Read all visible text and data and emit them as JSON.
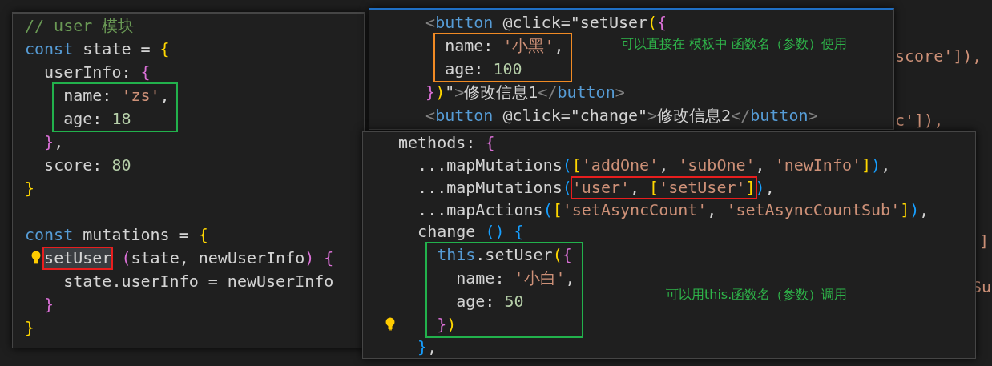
{
  "backdrop": {
    "fragments": [
      {
        "text": "score']),"
      },
      {
        "text": "c']),"
      },
      {
        "text": "]"
      },
      {
        "text": "Su"
      }
    ]
  },
  "panels": [
    {
      "accent": false,
      "blocks": [
        {
          "lines": [
            {
              "segments": [
                {
                  "tokens": [
                    {
                      "kind": "comment",
                      "text": "// user 模块"
                    }
                  ]
                }
              ]
            },
            {
              "segments": [
                {
                  "tokens": [
                    {
                      "kind": "keyword",
                      "text": "const"
                    },
                    {
                      "kind": "plain",
                      "text": " state = "
                    },
                    {
                      "kind": "bracket-1",
                      "text": "{"
                    }
                  ]
                }
              ]
            },
            {
              "segments": [
                {
                  "tokens": [
                    {
                      "kind": "plain",
                      "text": "  userInfo: "
                    },
                    {
                      "kind": "bracket-2",
                      "text": "{"
                    }
                  ]
                }
              ]
            }
          ]
        },
        {
          "color": "#22b14c",
          "lines": [
            {
              "segments": [
                {
                  "tokens": [
                    {
                      "kind": "plain",
                      "text": "    name: "
                    },
                    {
                      "kind": "string",
                      "text": "'zs'"
                    },
                    {
                      "kind": "plain",
                      "text": ","
                    }
                  ]
                }
              ]
            },
            {
              "segments": [
                {
                  "tokens": [
                    {
                      "kind": "plain",
                      "text": "    age: "
                    },
                    {
                      "kind": "number",
                      "text": "18"
                    }
                  ]
                }
              ]
            }
          ]
        },
        {
          "lines": [
            {
              "segments": [
                {
                  "tokens": [
                    {
                      "kind": "bracket-2",
                      "text": "  }"
                    },
                    {
                      "kind": "plain",
                      "text": ","
                    }
                  ]
                }
              ]
            },
            {
              "segments": [
                {
                  "tokens": [
                    {
                      "kind": "plain",
                      "text": "  score: "
                    },
                    {
                      "kind": "number",
                      "text": "80"
                    }
                  ]
                }
              ]
            },
            {
              "segments": [
                {
                  "tokens": [
                    {
                      "kind": "bracket-1",
                      "text": "}"
                    }
                  ]
                }
              ]
            },
            {
              "gap_before": true,
              "segments": [
                {
                  "tokens": [
                    {
                      "kind": "keyword",
                      "text": "const"
                    },
                    {
                      "kind": "plain",
                      "text": " mutations = "
                    },
                    {
                      "kind": "bracket-1",
                      "text": "{"
                    }
                  ]
                }
              ]
            },
            {
              "bulb": true,
              "segments": [
                {
                  "color": "#e81e1e",
                  "highlighted": true,
                  "tokens": [
                    {
                      "kind": "plain",
                      "text": "  setUser"
                    }
                  ]
                },
                {
                  "tokens": [
                    {
                      "kind": "bracket-2",
                      "text": " ("
                    },
                    {
                      "kind": "plain",
                      "text": "state, newUserInfo"
                    },
                    {
                      "kind": "bracket-2",
                      "text": ")"
                    },
                    {
                      "kind": "bracket-2",
                      "text": " {"
                    }
                  ]
                }
              ]
            },
            {
              "segments": [
                {
                  "tokens": [
                    {
                      "kind": "plain",
                      "text": "    state.userInfo = newUserInfo"
                    }
                  ]
                }
              ]
            },
            {
              "segments": [
                {
                  "tokens": [
                    {
                      "kind": "bracket-2",
                      "text": "  }"
                    }
                  ]
                }
              ]
            },
            {
              "segments": [
                {
                  "tokens": [
                    {
                      "kind": "bracket-1",
                      "text": "}"
                    }
                  ]
                }
              ]
            }
          ]
        }
      ]
    },
    {
      "accent": true,
      "note": "可以直接在 模板中 函数名（参数）使用",
      "blocks": [
        {
          "lines": [
            {
              "segments": [
                {
                  "tokens": [
                    {
                      "kind": "tag-punct",
                      "text": "  <"
                    },
                    {
                      "kind": "tag",
                      "text": "button"
                    },
                    {
                      "kind": "plain",
                      "text": " @click=\"setUser"
                    },
                    {
                      "kind": "bracket-1",
                      "text": "("
                    },
                    {
                      "kind": "bracket-2",
                      "text": "{"
                    }
                  ]
                }
              ]
            }
          ]
        },
        {
          "color": "#f08a24",
          "lines": [
            {
              "segments": [
                {
                  "tokens": [
                    {
                      "kind": "plain",
                      "text": "    name: "
                    },
                    {
                      "kind": "string",
                      "text": "'小黑'"
                    },
                    {
                      "kind": "plain",
                      "text": ","
                    }
                  ]
                }
              ]
            },
            {
              "segments": [
                {
                  "tokens": [
                    {
                      "kind": "plain",
                      "text": "    age: "
                    },
                    {
                      "kind": "number",
                      "text": "100"
                    }
                  ]
                }
              ]
            }
          ]
        },
        {
          "lines": [
            {
              "segments": [
                {
                  "tokens": [
                    {
                      "kind": "bracket-2",
                      "text": "  }"
                    },
                    {
                      "kind": "bracket-1",
                      "text": ")"
                    },
                    {
                      "kind": "plain",
                      "text": "\""
                    },
                    {
                      "kind": "tag-punct",
                      "text": ">"
                    },
                    {
                      "kind": "plain",
                      "text": "修改信息1"
                    },
                    {
                      "kind": "tag-punct",
                      "text": "</"
                    },
                    {
                      "kind": "tag",
                      "text": "button"
                    },
                    {
                      "kind": "tag-punct",
                      "text": ">"
                    }
                  ]
                }
              ]
            },
            {
              "segments": [
                {
                  "tokens": [
                    {
                      "kind": "tag-punct",
                      "text": "  <"
                    },
                    {
                      "kind": "tag",
                      "text": "button"
                    },
                    {
                      "kind": "plain",
                      "text": " @click=\"change\""
                    },
                    {
                      "kind": "tag-punct",
                      "text": ">"
                    },
                    {
                      "kind": "plain",
                      "text": "修改信息2"
                    },
                    {
                      "kind": "tag-punct",
                      "text": "</"
                    },
                    {
                      "kind": "tag",
                      "text": "button"
                    },
                    {
                      "kind": "tag-punct",
                      "text": ">"
                    }
                  ]
                }
              ]
            }
          ]
        }
      ]
    },
    {
      "accent": false,
      "note": "可以用this.函数名（参数）调用",
      "blocks": [
        {
          "lines": [
            {
              "segments": [
                {
                  "tokens": [
                    {
                      "kind": "plain",
                      "text": "methods: "
                    },
                    {
                      "kind": "bracket-2",
                      "text": "{"
                    }
                  ]
                }
              ]
            },
            {
              "segments": [
                {
                  "tokens": [
                    {
                      "kind": "plain",
                      "text": "  ...mapMutations"
                    },
                    {
                      "kind": "bracket-3",
                      "text": "("
                    },
                    {
                      "kind": "bracket-1",
                      "text": "["
                    },
                    {
                      "kind": "string",
                      "text": "'addOne'"
                    },
                    {
                      "kind": "plain",
                      "text": ", "
                    },
                    {
                      "kind": "string",
                      "text": "'subOne'"
                    },
                    {
                      "kind": "plain",
                      "text": ", "
                    },
                    {
                      "kind": "string",
                      "text": "'newInfo'"
                    },
                    {
                      "kind": "bracket-1",
                      "text": "]"
                    },
                    {
                      "kind": "bracket-3",
                      "text": ")"
                    },
                    {
                      "kind": "plain",
                      "text": ","
                    }
                  ]
                }
              ]
            },
            {
              "segments": [
                {
                  "tokens": [
                    {
                      "kind": "plain",
                      "text": "  ...mapMutations"
                    },
                    {
                      "kind": "bracket-3",
                      "text": "("
                    }
                  ]
                },
                {
                  "color": "#e81e1e",
                  "tokens": [
                    {
                      "kind": "string",
                      "text": "'user'"
                    },
                    {
                      "kind": "plain",
                      "text": ", "
                    },
                    {
                      "kind": "bracket-1",
                      "text": "["
                    },
                    {
                      "kind": "string",
                      "text": "'setUser'"
                    },
                    {
                      "kind": "bracket-1",
                      "text": "]"
                    }
                  ]
                },
                {
                  "tokens": [
                    {
                      "kind": "bracket-3",
                      "text": ")"
                    },
                    {
                      "kind": "plain",
                      "text": ","
                    }
                  ]
                }
              ]
            },
            {
              "segments": [
                {
                  "tokens": [
                    {
                      "kind": "plain",
                      "text": "  ...mapActions"
                    },
                    {
                      "kind": "bracket-3",
                      "text": "("
                    },
                    {
                      "kind": "bracket-1",
                      "text": "["
                    },
                    {
                      "kind": "string",
                      "text": "'setAsyncCount'"
                    },
                    {
                      "kind": "plain",
                      "text": ", "
                    },
                    {
                      "kind": "string",
                      "text": "'setAsyncCountSub'"
                    },
                    {
                      "kind": "bracket-1",
                      "text": "]"
                    },
                    {
                      "kind": "bracket-3",
                      "text": ")"
                    },
                    {
                      "kind": "plain",
                      "text": ","
                    }
                  ]
                }
              ]
            },
            {
              "segments": [
                {
                  "tokens": [
                    {
                      "kind": "plain",
                      "text": "  change "
                    },
                    {
                      "kind": "bracket-3",
                      "text": "()"
                    },
                    {
                      "kind": "bracket-3",
                      "text": " {"
                    }
                  ]
                }
              ]
            }
          ]
        },
        {
          "color": "#22b14c",
          "lines": [
            {
              "segments": [
                {
                  "tokens": [
                    {
                      "kind": "keyword",
                      "text": "    this"
                    },
                    {
                      "kind": "plain",
                      "text": ".setUser"
                    },
                    {
                      "kind": "bracket-1",
                      "text": "("
                    },
                    {
                      "kind": "bracket-2",
                      "text": "{"
                    }
                  ]
                }
              ]
            },
            {
              "segments": [
                {
                  "tokens": [
                    {
                      "kind": "plain",
                      "text": "      name: "
                    },
                    {
                      "kind": "string",
                      "text": "'小白'"
                    },
                    {
                      "kind": "plain",
                      "text": ","
                    }
                  ]
                }
              ]
            },
            {
              "segments": [
                {
                  "tokens": [
                    {
                      "kind": "plain",
                      "text": "      age: "
                    },
                    {
                      "kind": "number",
                      "text": "50"
                    }
                  ]
                }
              ]
            },
            {
              "bulb": true,
              "segments": [
                {
                  "tokens": [
                    {
                      "kind": "bracket-2",
                      "text": "    }"
                    },
                    {
                      "kind": "bracket-1",
                      "text": ")"
                    }
                  ]
                }
              ]
            }
          ]
        },
        {
          "lines": [
            {
              "segments": [
                {
                  "tokens": [
                    {
                      "kind": "bracket-3",
                      "text": "  }"
                    },
                    {
                      "kind": "plain",
                      "text": ","
                    }
                  ]
                }
              ]
            }
          ]
        }
      ]
    }
  ]
}
